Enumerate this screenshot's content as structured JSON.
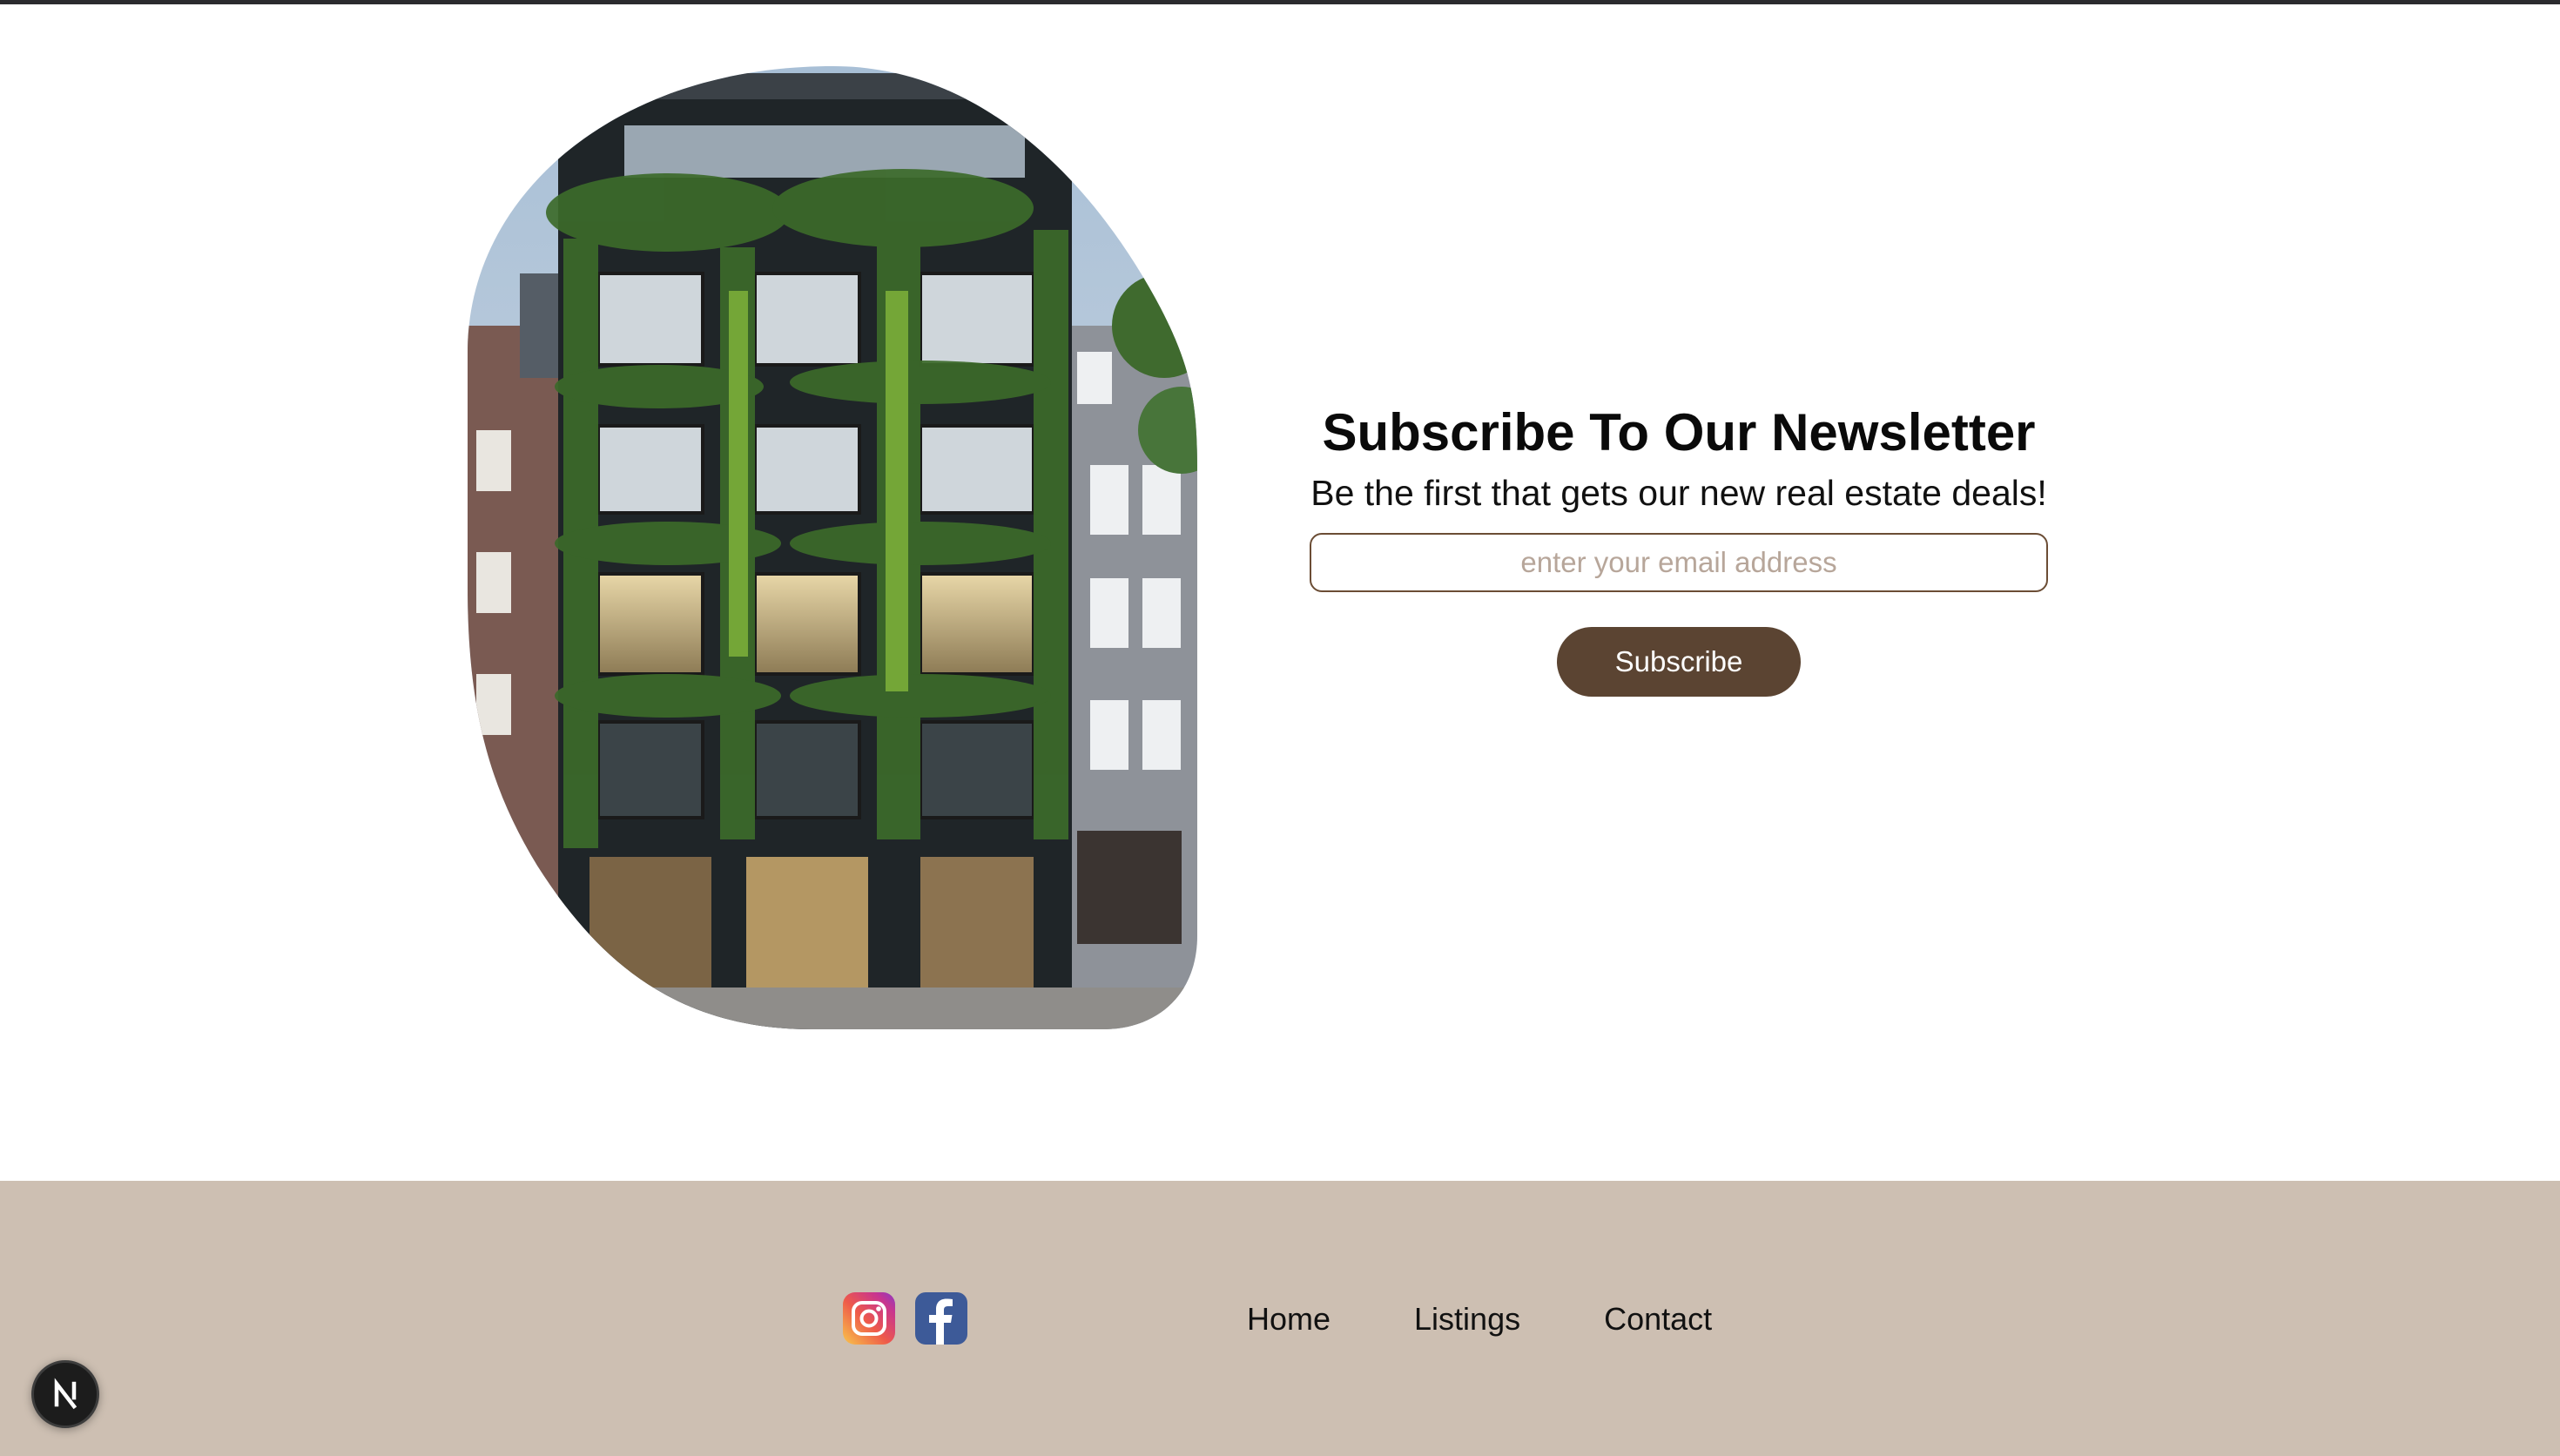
{
  "newsletter": {
    "title": "Subscribe To Our Newsletter",
    "subtitle": "Be the first that gets our new real estate deals!",
    "email_placeholder": "enter your email address",
    "email_value": "",
    "subscribe_label": "Subscribe"
  },
  "footer": {
    "social": [
      {
        "icon": "instagram-icon"
      },
      {
        "icon": "facebook-icon"
      }
    ],
    "nav": [
      {
        "label": "Home"
      },
      {
        "label": "Listings"
      },
      {
        "label": "Contact"
      }
    ]
  },
  "dev_badge": {
    "icon": "nextjs-icon"
  },
  "colors": {
    "accent": "#5b4432",
    "input_border": "#6b4d35",
    "footer_bg": "#cdbfb2",
    "placeholder": "#b7a69a"
  }
}
